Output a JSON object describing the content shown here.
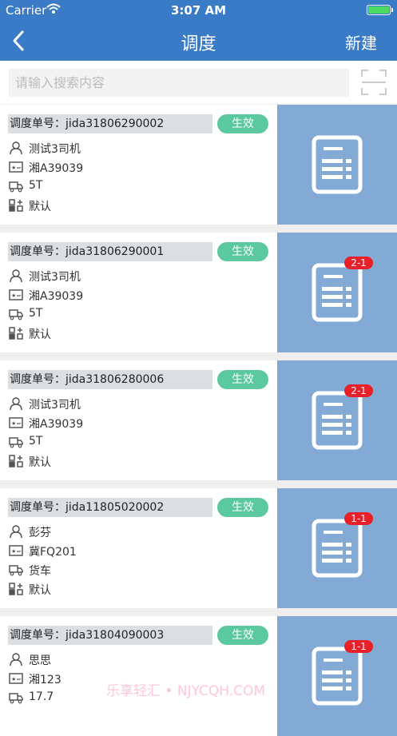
{
  "status_bar": {
    "carrier": "Carrier",
    "time": "3:07 AM"
  },
  "nav": {
    "title": "调度",
    "new_label": "新建"
  },
  "search": {
    "placeholder": "请输入搜索内容"
  },
  "colors": {
    "primary": "#3a7bc8",
    "badge": "#5cc8a0",
    "side_panel": "#82aad4",
    "count_tag": "#e8202a"
  },
  "cards": [
    {
      "order_label": "调度单号：",
      "order_no": "jida31806290002",
      "status": "生效",
      "driver": "测试3司机",
      "plate": "湘A39039",
      "load": "5T",
      "route": "默认",
      "count": ""
    },
    {
      "order_label": "调度单号：",
      "order_no": "jida31806290001",
      "status": "生效",
      "driver": "测试3司机",
      "plate": "湘A39039",
      "load": "5T",
      "route": "默认",
      "count": "2-1"
    },
    {
      "order_label": "调度单号：",
      "order_no": "jida31806280006",
      "status": "生效",
      "driver": "测试3司机",
      "plate": "湘A39039",
      "load": "5T",
      "route": "默认",
      "count": "2-1"
    },
    {
      "order_label": "调度单号：",
      "order_no": "jida11805020002",
      "status": "生效",
      "driver": "彭芬",
      "plate": "冀FQ201",
      "load": "货车",
      "route": "默认",
      "count": "1-1"
    },
    {
      "order_label": "调度单号：",
      "order_no": "jida31804090003",
      "status": "生效",
      "driver": "思思",
      "plate": "湘123",
      "load": "17.7",
      "route": "",
      "count": "1-1"
    }
  ],
  "watermark": "乐享轻汇 • NJYCQH.COM"
}
